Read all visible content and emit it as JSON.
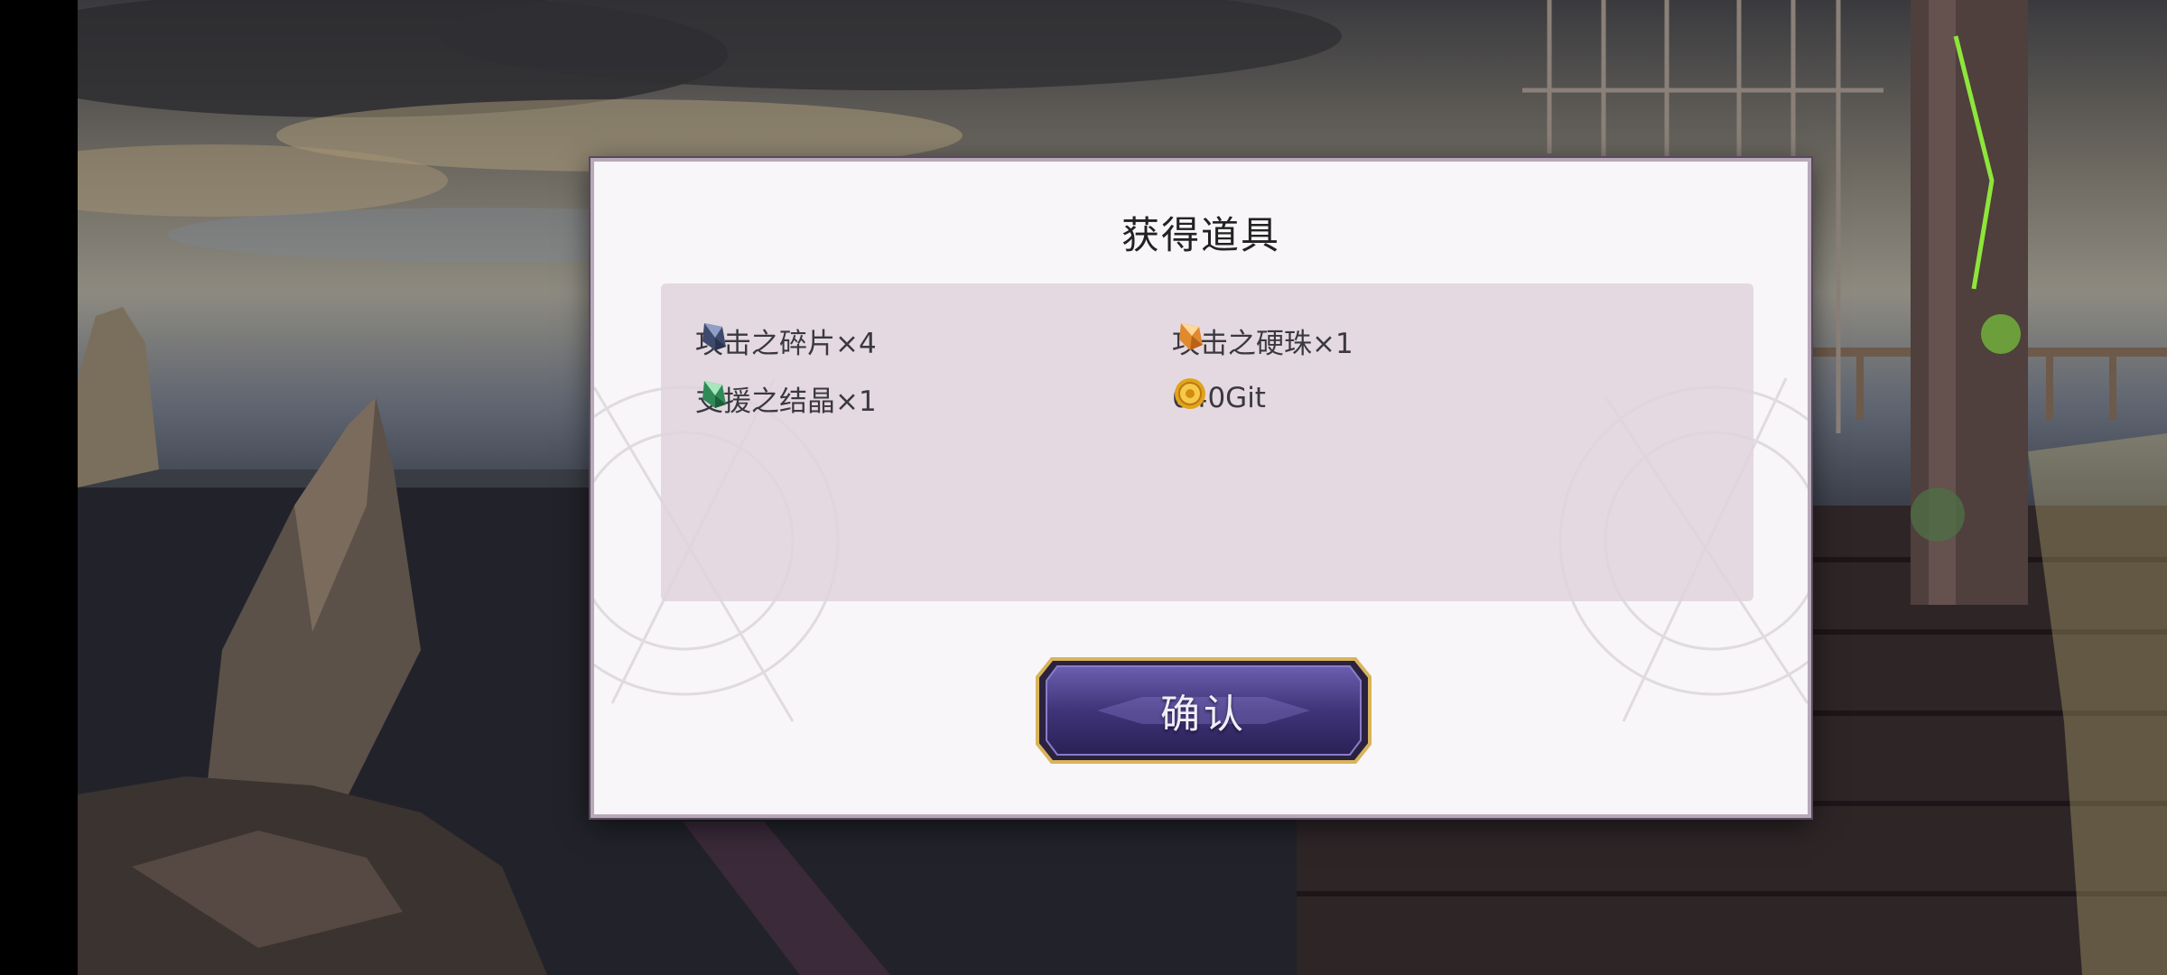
{
  "dialog": {
    "title": "获得道具",
    "confirm_label": "确认"
  },
  "items": [
    {
      "label": "攻击之碎片×4",
      "icon": "blue-crystal-shard-icon",
      "color": "#5c6f9e"
    },
    {
      "label": "攻击之硬珠×1",
      "icon": "orange-crystal-icon",
      "color": "#f0a040"
    },
    {
      "label": "支援之结晶×1",
      "icon": "green-crystal-icon",
      "color": "#3fa06a"
    },
    {
      "label": "640Git",
      "icon": "gold-coin-icon",
      "color": "#e2a21a"
    }
  ],
  "colors": {
    "panel": "#e0d4dc",
    "button_fill": "#4b3f8a",
    "button_border": "#d8b45a"
  }
}
